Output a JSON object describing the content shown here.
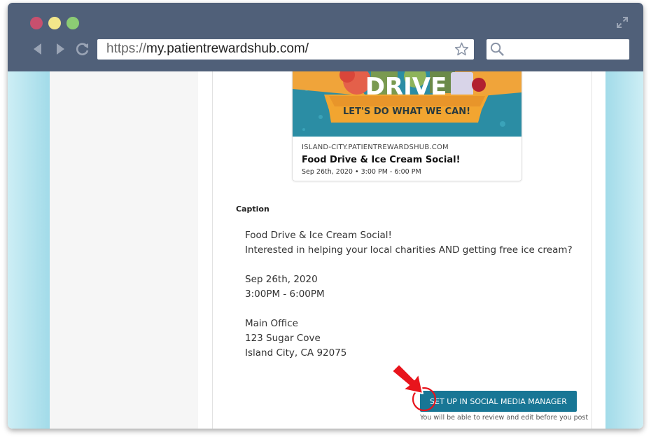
{
  "browser": {
    "url_scheme": "https://",
    "url_host": "my.patientrewardshub.com/",
    "search_placeholder": ""
  },
  "preview": {
    "image_headline": "DRIVE",
    "image_banner": "LET'S DO WHAT WE CAN!",
    "domain": "ISLAND-CITY.PATIENTREWARDSHUB.COM",
    "title": "Food Drive & Ice Cream Social!",
    "date": "Sep 26th, 2020 • 3:00 PM - 6:00 PM"
  },
  "caption": {
    "label": "Caption",
    "lines": [
      "Food Drive & Ice Cream Social!",
      "Interested in helping your local charities AND getting free ice cream?",
      "",
      "Sep 26th, 2020",
      "3:00PM - 6:00PM",
      "",
      "Main Office",
      "123 Sugar Cove",
      "Island City, CA 92075"
    ]
  },
  "cta": {
    "label": "SET UP IN SOCIAL MEDIA MANAGER",
    "note": "You will be able to review and edit before you post"
  },
  "colors": {
    "chrome": "#506079",
    "cta": "#187695",
    "accent_side": "#a2dbe9",
    "pointer": "#e8141c"
  }
}
